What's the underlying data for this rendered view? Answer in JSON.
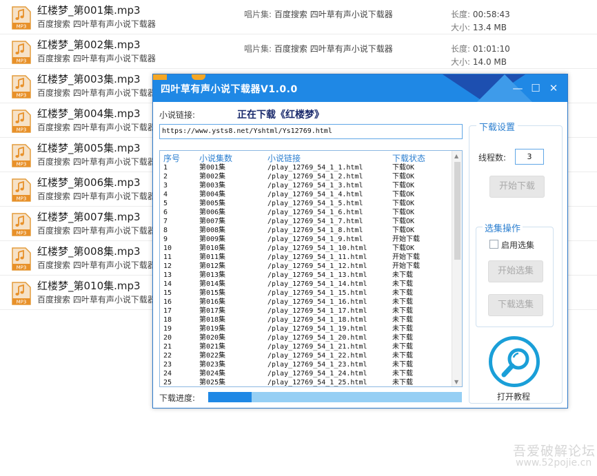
{
  "background_list": {
    "items": [
      {
        "name": "红楼梦_第001集.mp3",
        "sub": "百度搜索 四叶草有声小说下载器",
        "album_label": "唱片集:",
        "album": "百度搜索 四叶草有声小说下载器",
        "length_label": "长度:",
        "length": "00:58:43",
        "size_label": "大小:",
        "size": "13.4 MB"
      },
      {
        "name": "红楼梦_第002集.mp3",
        "sub": "百度搜索 四叶草有声小说下载器",
        "album_label": "唱片集:",
        "album": "百度搜索 四叶草有声小说下载器",
        "length_label": "长度:",
        "length": "01:01:10",
        "size_label": "大小:",
        "size": "14.0 MB"
      },
      {
        "name": "红楼梦_第003集.mp3",
        "sub": "百度搜索 四叶草有声小说下载器"
      },
      {
        "name": "红楼梦_第004集.mp3",
        "sub": "百度搜索 四叶草有声小说下载器"
      },
      {
        "name": "红楼梦_第005集.mp3",
        "sub": "百度搜索 四叶草有声小说下载器"
      },
      {
        "name": "红楼梦_第006集.mp3",
        "sub": "百度搜索 四叶草有声小说下载器"
      },
      {
        "name": "红楼梦_第007集.mp3",
        "sub": "百度搜索 四叶草有声小说下载器"
      },
      {
        "name": "红楼梦_第008集.mp3",
        "sub": "百度搜索 四叶草有声小说下载器"
      },
      {
        "name": "红楼梦_第010集.mp3",
        "sub": "百度搜索 四叶草有声小说下载器"
      }
    ],
    "icon": "mp3-file-icon",
    "icon_text": "MP3"
  },
  "window": {
    "title": "四叶草有声小说下载器V1.0.0",
    "min_glyph": "—",
    "max_glyph": "☐",
    "close_glyph": "✕",
    "accent": "#1f88e5"
  },
  "form": {
    "link_label": "小说链接:",
    "status_text": "正在下载《红楼梦》",
    "url_value": "https://www.ysts8.net/Yshtml/Ys12769.html"
  },
  "table": {
    "headers": [
      "序号",
      "小说集数",
      "小说链接",
      "下载状态"
    ],
    "rows": [
      [
        "1",
        "第001集",
        "/play_12769_54_1_1.html",
        "下载OK"
      ],
      [
        "2",
        "第002集",
        "/play_12769_54_1_2.html",
        "下载OK"
      ],
      [
        "3",
        "第003集",
        "/play_12769_54_1_3.html",
        "下载OK"
      ],
      [
        "4",
        "第004集",
        "/play_12769_54_1_4.html",
        "下载OK"
      ],
      [
        "5",
        "第005集",
        "/play_12769_54_1_5.html",
        "下载OK"
      ],
      [
        "6",
        "第006集",
        "/play_12769_54_1_6.html",
        "下载OK"
      ],
      [
        "7",
        "第007集",
        "/play_12769_54_1_7.html",
        "下载OK"
      ],
      [
        "8",
        "第008集",
        "/play_12769_54_1_8.html",
        "下载OK"
      ],
      [
        "9",
        "第009集",
        "/play_12769_54_1_9.html",
        "开始下载"
      ],
      [
        "10",
        "第010集",
        "/play_12769_54_1_10.html",
        "下载OK"
      ],
      [
        "11",
        "第011集",
        "/play_12769_54_1_11.html",
        "开始下载"
      ],
      [
        "12",
        "第012集",
        "/play_12769_54_1_12.html",
        "开始下载"
      ],
      [
        "13",
        "第013集",
        "/play_12769_54_1_13.html",
        "未下载"
      ],
      [
        "14",
        "第014集",
        "/play_12769_54_1_14.html",
        "未下载"
      ],
      [
        "15",
        "第015集",
        "/play_12769_54_1_15.html",
        "未下载"
      ],
      [
        "16",
        "第016集",
        "/play_12769_54_1_16.html",
        "未下载"
      ],
      [
        "17",
        "第017集",
        "/play_12769_54_1_17.html",
        "未下载"
      ],
      [
        "18",
        "第018集",
        "/play_12769_54_1_18.html",
        "未下载"
      ],
      [
        "19",
        "第019集",
        "/play_12769_54_1_19.html",
        "未下载"
      ],
      [
        "20",
        "第020集",
        "/play_12769_54_1_20.html",
        "未下载"
      ],
      [
        "21",
        "第021集",
        "/play_12769_54_1_21.html",
        "未下载"
      ],
      [
        "22",
        "第022集",
        "/play_12769_54_1_22.html",
        "未下载"
      ],
      [
        "23",
        "第023集",
        "/play_12769_54_1_23.html",
        "未下载"
      ],
      [
        "24",
        "第024集",
        "/play_12769_54_1_24.html",
        "未下载"
      ],
      [
        "25",
        "第025集",
        "/play_12769_54_1_25.html",
        "未下载"
      ]
    ]
  },
  "progress": {
    "label": "下载进度:",
    "fraction": 0.17
  },
  "settings": {
    "title": "下载设置",
    "threads_label": "线程数:",
    "threads_value": "3",
    "start_button": "开始下载",
    "select_group_title": "选集操作",
    "enable_select_label": "启用选集",
    "start_select_button": "开始选集",
    "download_select_button": "下载选集",
    "help_label": "打开教程",
    "help_icon": "magnifier-icon"
  },
  "watermark": {
    "line1": "吾爱破解论坛",
    "line2": "www.52pojie.cn"
  }
}
